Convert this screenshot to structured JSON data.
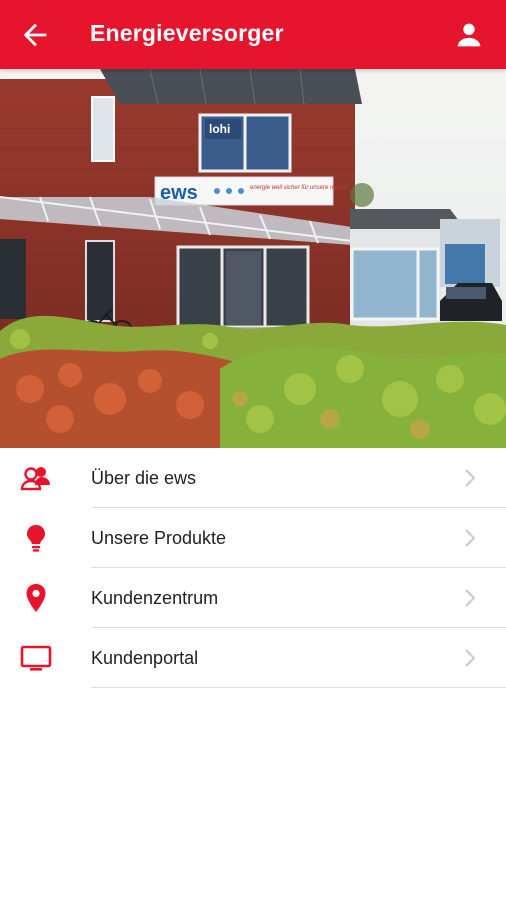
{
  "header": {
    "title": "Energieversorger"
  },
  "hero": {
    "sign_logo": "ews",
    "sign_slogan": "energie weil sicher für unsere region",
    "window_sign": "lohi"
  },
  "menu": [
    {
      "label": "Über die ews",
      "icon": "people-icon"
    },
    {
      "label": "Unsere Produkte",
      "icon": "lightbulb-icon"
    },
    {
      "label": "Kundenzentrum",
      "icon": "location-pin-icon"
    },
    {
      "label": "Kundenportal",
      "icon": "monitor-icon"
    }
  ],
  "colors": {
    "primary": "#e6142d"
  }
}
